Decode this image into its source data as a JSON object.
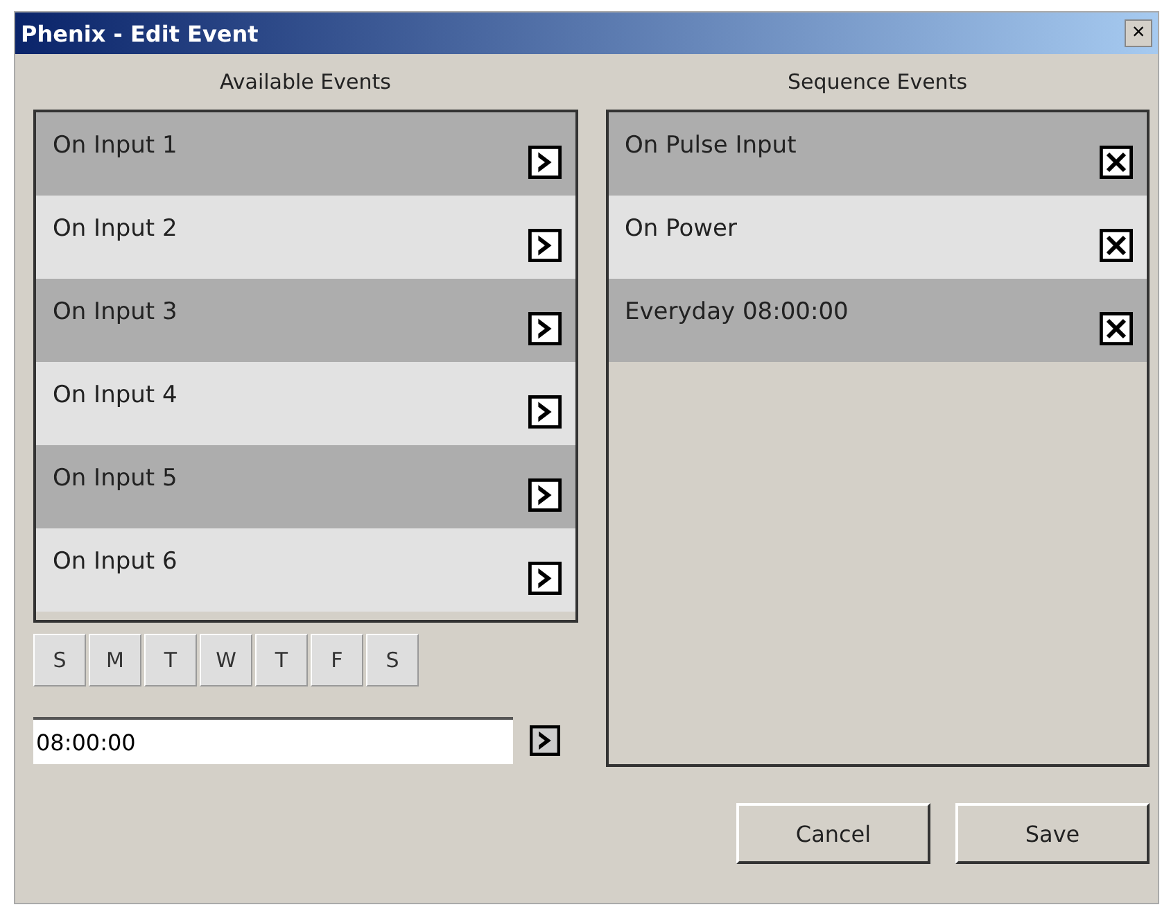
{
  "window": {
    "title": "Phenix - Edit Event",
    "close": "×"
  },
  "available": {
    "heading": "Available Events",
    "items": [
      {
        "label": "On Input 1"
      },
      {
        "label": "On Input 2"
      },
      {
        "label": "On Input 3"
      },
      {
        "label": "On Input 4"
      },
      {
        "label": "On Input 5"
      },
      {
        "label": "On Input 6"
      }
    ]
  },
  "days": [
    "S",
    "M",
    "T",
    "W",
    "T",
    "F",
    "S"
  ],
  "time": {
    "value": "08:00:00"
  },
  "sequence": {
    "heading": "Sequence Events",
    "items": [
      {
        "label": "On Pulse Input"
      },
      {
        "label": "On Power"
      },
      {
        "label": "Everyday 08:00:00"
      }
    ]
  },
  "buttons": [
    "Cancel",
    "Save"
  ]
}
